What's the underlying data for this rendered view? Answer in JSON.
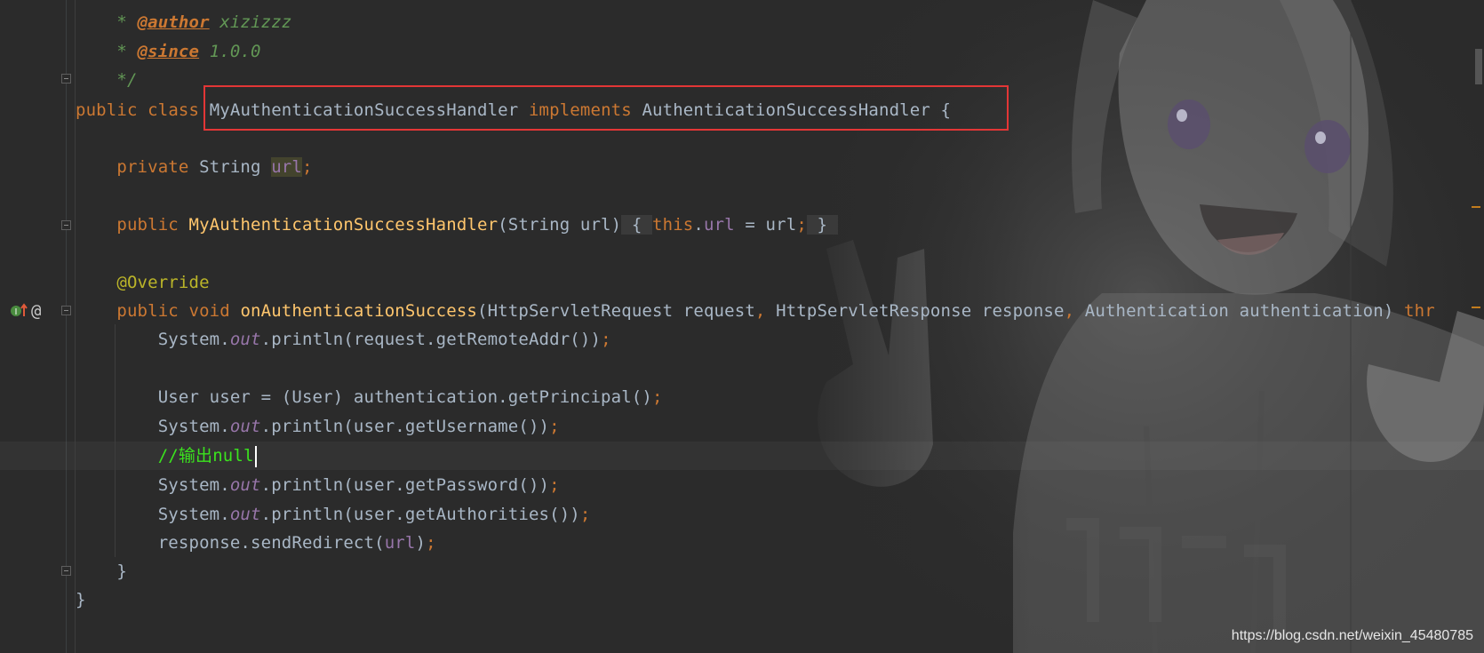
{
  "editor": {
    "language": "java",
    "colors": {
      "background": "#2b2b2b",
      "keyword": "#cc7832",
      "method": "#ffc66d",
      "field": "#9876aa",
      "comment": "#3be31e",
      "highlight_box": "#e33636"
    },
    "lines": {
      "author_star": "*",
      "author_tag": "@author",
      "author_value": "xizizzz",
      "since_star": "*",
      "since_tag": "@since",
      "since_value": "1.0.0",
      "doc_end": "*/",
      "class_kw_public": "public",
      "class_kw_class": "class",
      "class_name": "MyAuthenticationSuccessHandler",
      "class_kw_implements": "implements",
      "class_interface": "AuthenticationSuccessHandler",
      "class_brace": "{",
      "field_kw": "private",
      "field_type": "String",
      "field_name": "url",
      "field_semi": ";",
      "ctor_kw": "public",
      "ctor_name": "MyAuthenticationSuccessHandler",
      "ctor_params": "(String url)",
      "ctor_open": "{",
      "ctor_this": "this",
      "ctor_dot": ".",
      "ctor_field": "url",
      "ctor_assign": " = url",
      "ctor_semi": ";",
      "ctor_close": "}",
      "override": "@Override",
      "method_kw_public": "public",
      "method_kw_void": "void",
      "method_name": "onAuthenticationSuccess",
      "method_p1": "(HttpServletRequest request",
      "method_comma1": ",",
      "method_p2": " HttpServletResponse response",
      "method_comma2": ",",
      "method_p3": " Authentication authentication)",
      "method_throws": "thr",
      "l1_a": "System.",
      "l1_out": "out",
      "l1_b": ".println(request.getRemoteAddr())",
      "l1_semi": ";",
      "l2_a": "User user = (User) authentication.getPrincipal()",
      "l2_semi": ";",
      "l3_a": "System.",
      "l3_out": "out",
      "l3_b": ".println(user.getUsername())",
      "l3_semi": ";",
      "comment": "//输出null",
      "l4_a": "System.",
      "l4_out": "out",
      "l4_b": ".println(user.getPassword())",
      "l4_semi": ";",
      "l5_a": "System.",
      "l5_out": "out",
      "l5_b": ".println(user.getAuthorities())",
      "l5_semi": ";",
      "l6_a": "response.sendRedirect(",
      "l6_field": "url",
      "l6_b": ")",
      "l6_semi": ";",
      "method_close": "}",
      "class_close": "}"
    },
    "gutter_icons": [
      "implements-method-icon",
      "annotation-at-icon"
    ],
    "gutter_at": "@"
  },
  "watermark": {
    "text": "https://blog.csdn.net/weixin_45480785"
  }
}
